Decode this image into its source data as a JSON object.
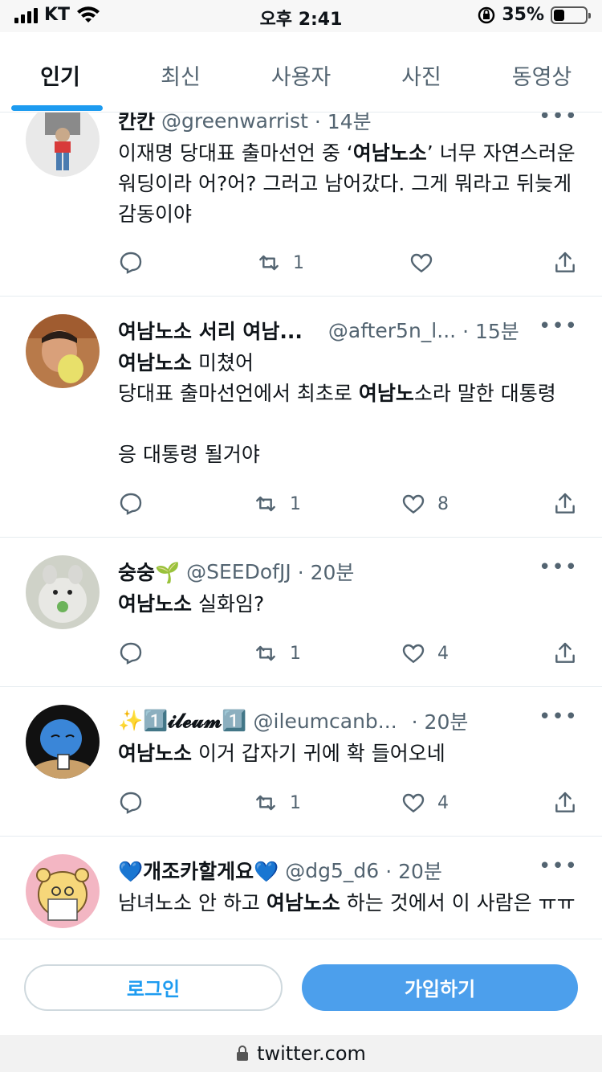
{
  "status_bar": {
    "carrier": "KT",
    "time": "오후 2:41",
    "battery": "35%"
  },
  "tabs": [
    {
      "label": "인기",
      "active": true
    },
    {
      "label": "최신"
    },
    {
      "label": "사용자"
    },
    {
      "label": "사진"
    },
    {
      "label": "동영상"
    }
  ],
  "tweets": [
    {
      "name": "칸칸",
      "handle": "@greenwarrist",
      "time": "· 14분",
      "text_parts": [
        "이재명 당대표 출마선언 중 ‘",
        "여남노소",
        "’ 너무 자연스러운 워딩이라 어?어? 그러고 남어갔다. 그게 뭐라고 뒤늦게 감동이야"
      ],
      "retweets": "1",
      "likes": ""
    },
    {
      "name": "여남노소 서리 여남...",
      "handle": "@after5n_l...",
      "time": "· 15분",
      "line1_bold": "여남노소",
      "line1_rest": " 미쳤어",
      "line2_pre": "당대표 출마선언에서 최초로 ",
      "line2_bold": "여남노",
      "line2_post": "소라 말한 대통령",
      "line3": "응 대통령 될거야",
      "retweets": "1",
      "likes": "8"
    },
    {
      "name": "숭숭🌱",
      "handle": "@SEEDofJJ",
      "time": "· 20분",
      "text_bold": "여남노소",
      "text_rest": " 실화임?",
      "retweets": "1",
      "likes": "4"
    },
    {
      "name": "✨1️⃣𝓲𝓵𝓮𝓾𝓶1️⃣",
      "handle": "@ileumcanb...",
      "time": "· 20분",
      "text_bold": "여남노소",
      "text_rest": " 이거 갑자기 귀에 확 들어오네",
      "retweets": "1",
      "likes": "4"
    },
    {
      "name": "💙개조카할게요💙",
      "handle": "@dg5_d6",
      "time": "· 20분",
      "text_pre": "남녀노소 안 하고 ",
      "text_bold": "여남노소",
      "text_post": " 하는 것에서 이 사람은 ㅠㅠ"
    }
  ],
  "bottom": {
    "login": "로그인",
    "signup": "가입하기"
  },
  "url": "twitter.com",
  "more_glyph": "•••"
}
